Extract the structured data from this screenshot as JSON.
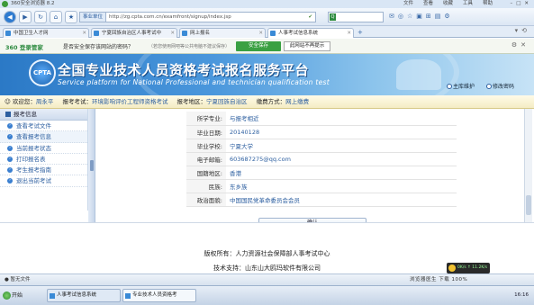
{
  "browser": {
    "title": "360安全浏览器 8.2",
    "menus": [
      "文件",
      "查看",
      "收藏",
      "工具",
      "帮助"
    ],
    "zone_label": "事业单位",
    "url": "http://zg.cpta.com.cn/examfront/signup/index.jsp",
    "search_engine_icon": "360-search-icon"
  },
  "tabs": [
    {
      "label": "中国卫生人才网"
    },
    {
      "label": "宁夏回族自治区人事考试中"
    },
    {
      "label": "网上报名"
    },
    {
      "label": "人事考试信息系统"
    }
  ],
  "security_bar": {
    "brand": "360 登录管家",
    "question": "是否安全保存该网站的密码？",
    "hint": "（若您使用网吧等公共电脑不建议保存）",
    "save_label": "安全保存",
    "never_label": "此网站不再提示"
  },
  "site": {
    "emblem_text": "CPTA",
    "title_cn": "全国专业技术人员资格考试报名服务平台",
    "title_en": "Service platform for National Professional and technician qualification test",
    "home_link": "主库维护",
    "pwd_link": "修改密码"
  },
  "infobar": {
    "welcome_label": "欢迎您：",
    "welcome_name": "周永平",
    "exam_label": "报考考试：",
    "exam_value": "环境影响评价工程师资格考试",
    "region_label": "报考地区：",
    "region_value": "宁夏回族自治区",
    "fee_label": "缴费方式：",
    "fee_value": "网上缴费"
  },
  "sidebar": {
    "header": "报考信息",
    "items": [
      {
        "label": "查看考试文件"
      },
      {
        "label": "查看报考信息"
      },
      {
        "label": "当前报考状态"
      },
      {
        "label": "打印报名表"
      },
      {
        "label": "考生报考指南"
      },
      {
        "label": "退出当前考试"
      }
    ]
  },
  "form": {
    "rows": [
      {
        "label": "所学专业:",
        "value": "与报考相近"
      },
      {
        "label": "毕业日期:",
        "value": "20140128"
      },
      {
        "label": "毕业学校:",
        "value": "宁夏大学"
      },
      {
        "label": "电子邮箱:",
        "value": "603687275@qq.com"
      },
      {
        "label": "国籍地区:",
        "value": "香港"
      },
      {
        "label": "民族:",
        "value": "东乡族"
      },
      {
        "label": "政治面貌:",
        "value": "中国国民党革命委员会会员"
      }
    ],
    "confirm_label": "确认"
  },
  "footer": {
    "copyright_label": "版权所有：",
    "copyright_value": "人力资源社会保障部人事考试中心",
    "support_label": "技术支持：",
    "support_value": "山东山大鸥玛软件有限公司"
  },
  "speed_widget": "0K/s ↑ 11.2K/s",
  "statusbar": {
    "left": "● 暂无文件",
    "right": "浏览器医生  下载  100%"
  },
  "taskbar": {
    "start_label": "开始",
    "tasks": [
      {
        "label": "人事考试信息系统"
      },
      {
        "label": "专业技术人员资格考"
      }
    ],
    "tray_text": "16:16"
  },
  "colors": {
    "banner_blue": "#2b79c6",
    "link_blue": "#2d5fa0",
    "infobar_bg": "#fffbe8",
    "save_green": "#3aa042"
  }
}
